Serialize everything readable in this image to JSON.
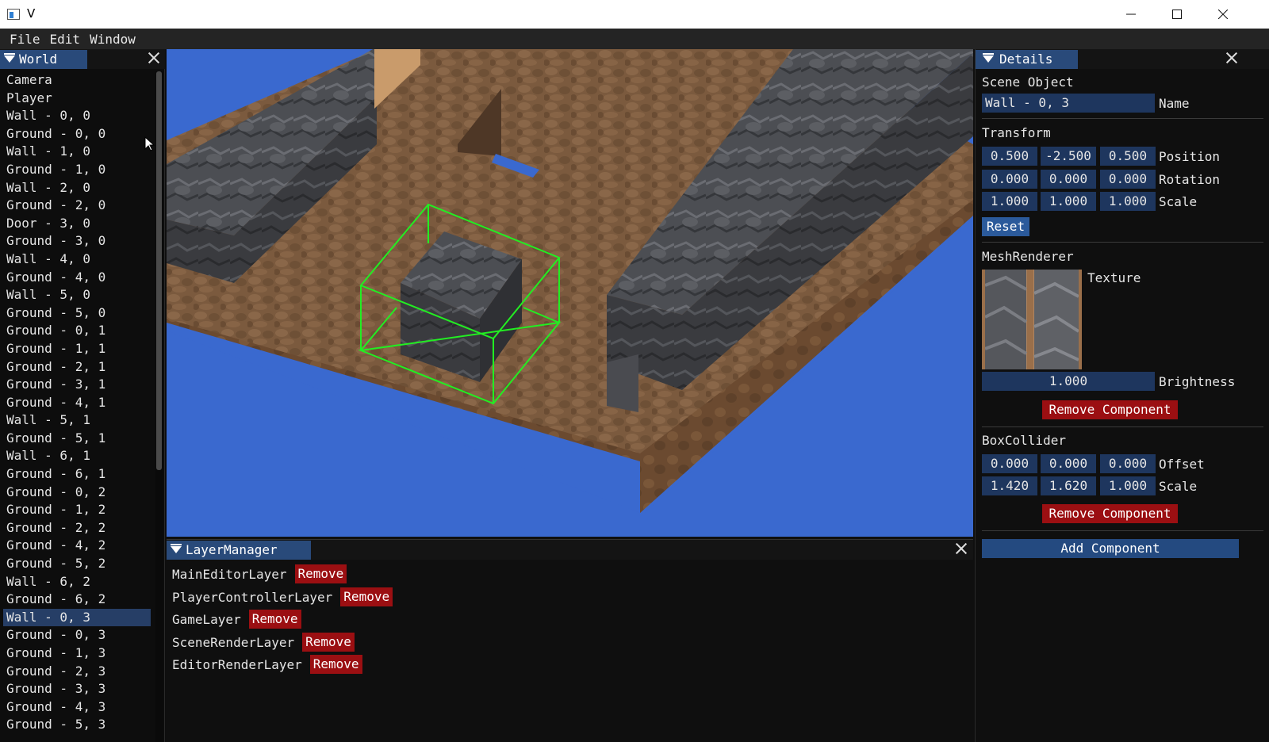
{
  "window": {
    "title": "V"
  },
  "menu": [
    "File",
    "Edit",
    "Window"
  ],
  "world": {
    "tab": "World",
    "items": [
      "Camera",
      "Player",
      "Wall - 0, 0",
      "Ground - 0, 0",
      "Wall - 1, 0",
      "Ground - 1, 0",
      "Wall - 2, 0",
      "Ground - 2, 0",
      "Door - 3, 0",
      "Ground - 3, 0",
      "Wall - 4, 0",
      "Ground - 4, 0",
      "Wall - 5, 0",
      "Ground - 5, 0",
      "Ground - 0, 1",
      "Ground - 1, 1",
      "Ground - 2, 1",
      "Ground - 3, 1",
      "Ground - 4, 1",
      "Wall - 5, 1",
      "Ground - 5, 1",
      "Wall - 6, 1",
      "Ground - 6, 1",
      "Ground - 0, 2",
      "Ground - 1, 2",
      "Ground - 2, 2",
      "Ground - 4, 2",
      "Ground - 5, 2",
      "Wall - 6, 2",
      "Ground - 6, 2",
      "Wall - 0, 3",
      "Ground - 0, 3",
      "Ground - 1, 3",
      "Ground - 2, 3",
      "Ground - 3, 3",
      "Ground - 4, 3",
      "Ground - 5, 3"
    ],
    "selected_index": 30
  },
  "layers": {
    "tab": "LayerManager",
    "remove_label": "Remove",
    "items": [
      "MainEditorLayer",
      "PlayerControllerLayer",
      "GameLayer",
      "SceneRenderLayer",
      "EditorRenderLayer"
    ]
  },
  "details": {
    "tab": "Details",
    "scene_object": {
      "heading": "Scene Object",
      "name_value": "Wall - 0, 3",
      "name_label": "Name"
    },
    "transform": {
      "heading": "Transform",
      "position": [
        "0.500",
        "-2.500",
        "0.500"
      ],
      "position_label": "Position",
      "rotation": [
        "0.000",
        "0.000",
        "0.000"
      ],
      "rotation_label": "Rotation",
      "scale": [
        "1.000",
        "1.000",
        "1.000"
      ],
      "scale_label": "Scale",
      "reset_label": "Reset"
    },
    "mesh_renderer": {
      "heading": "MeshRenderer",
      "texture_label": "Texture",
      "brightness_value": "1.000",
      "brightness_label": "Brightness",
      "remove_label": "Remove Component"
    },
    "box_collider": {
      "heading": "BoxCollider",
      "offset": [
        "0.000",
        "0.000",
        "0.000"
      ],
      "offset_label": "Offset",
      "scale": [
        "1.420",
        "1.620",
        "1.000"
      ],
      "scale_label": "Scale",
      "remove_label": "Remove Component"
    },
    "add_component_label": "Add Component"
  },
  "colors": {
    "viewport_bg": "#3a69cf",
    "selection_box": "#22ee22",
    "tab_active": "#294a7a",
    "field_bg": "#1e365e",
    "danger": "#9b0f12"
  }
}
